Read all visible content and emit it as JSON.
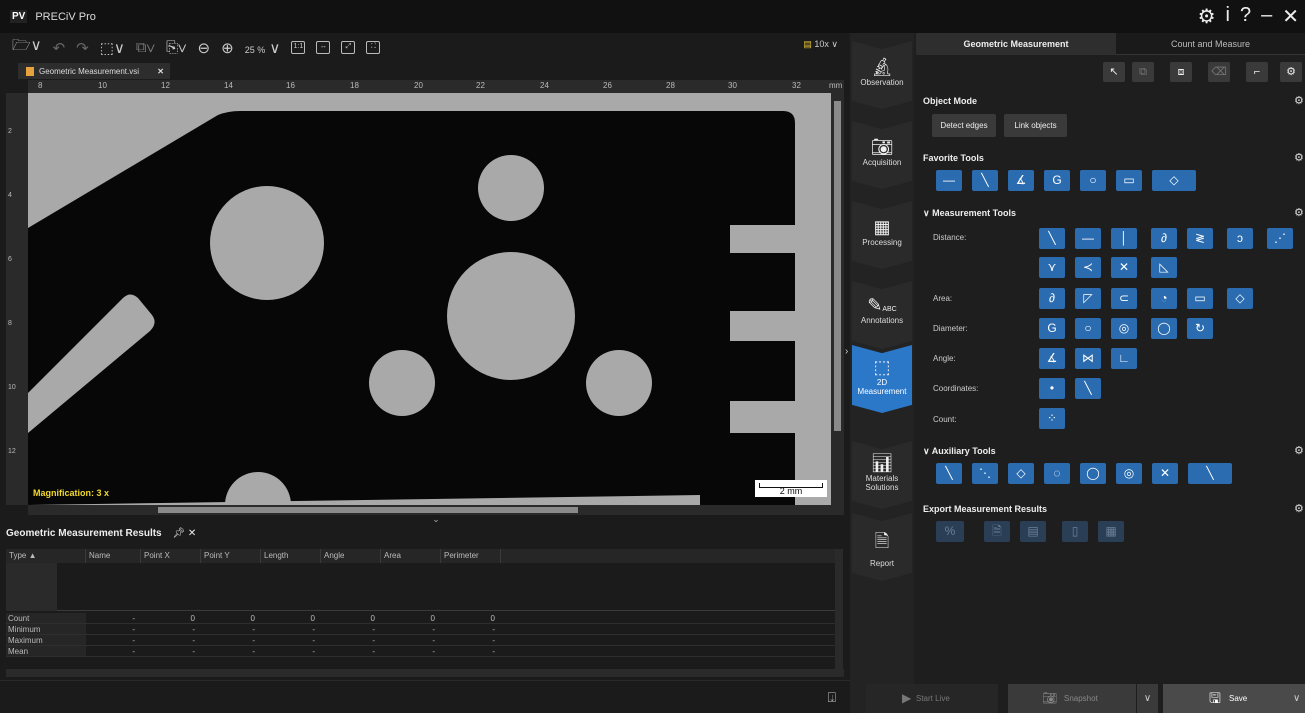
{
  "app": {
    "logo": "PV",
    "title": "PRECiV Pro"
  },
  "window_buttons": [
    "⚙",
    "i",
    "?",
    "–",
    "✕"
  ],
  "toolbar": {
    "zoom": "25 %",
    "zoom_chevron": "∨",
    "objective": "10x",
    "objective_chevron": "∨",
    "btn_1to1": "1:1"
  },
  "document_tab": {
    "name": "Geometric Measurement.vsi",
    "close": "✕"
  },
  "ruler": {
    "unit": "mm",
    "h_ticks": [
      "8",
      "10",
      "12",
      "14",
      "16",
      "18",
      "20",
      "22",
      "24",
      "26",
      "28",
      "30",
      "32"
    ],
    "v_ticks": [
      "2",
      "4",
      "6",
      "8",
      "10",
      "12"
    ]
  },
  "image": {
    "magnification": "Magnification:  3 x",
    "scale_label": "2 mm"
  },
  "results": {
    "title": "Geometric Measurement Results",
    "columns": [
      "Type",
      "Name",
      "Point X",
      "Point Y",
      "Length",
      "Angle",
      "Area",
      "Perimeter"
    ],
    "stats": [
      {
        "label": "Count",
        "values": [
          "-",
          "0",
          "0",
          "0",
          "0",
          "0",
          "0"
        ]
      },
      {
        "label": "Minimum",
        "values": [
          "-",
          "-",
          "-",
          "-",
          "-",
          "-",
          "-"
        ]
      },
      {
        "label": "Maximum",
        "values": [
          "-",
          "-",
          "-",
          "-",
          "-",
          "-",
          "-"
        ]
      },
      {
        "label": "Mean",
        "values": [
          "-",
          "-",
          "-",
          "-",
          "-",
          "-",
          "-"
        ]
      }
    ]
  },
  "sidebar": {
    "items": [
      {
        "label": "Observation"
      },
      {
        "label": "Acquisition"
      },
      {
        "label": "Processing"
      },
      {
        "label": "Annotations",
        "icon_text": "ABC"
      },
      {
        "label": "2D Measurement"
      },
      {
        "label": "Materials Solutions"
      },
      {
        "label": "Report"
      }
    ]
  },
  "right_panel": {
    "tabs": [
      "Geometric Measurement",
      "Count and Measure"
    ],
    "object_mode": {
      "title": "Object Mode",
      "buttons": [
        "Detect edges",
        "Link objects"
      ]
    },
    "favorite_tools": {
      "title": "Favorite Tools"
    },
    "measurement_tools": {
      "title": "Measurement Tools",
      "labels": [
        "Distance:",
        "Area:",
        "Diameter:",
        "Angle:",
        "Coordinates:",
        "Count:"
      ]
    },
    "auxiliary_tools": {
      "title": "Auxiliary Tools"
    },
    "export": {
      "title": "Export Measurement Results"
    }
  },
  "bottom_buttons": {
    "start_live": "Start Live",
    "snapshot": "Snapshot",
    "save": "Save"
  }
}
